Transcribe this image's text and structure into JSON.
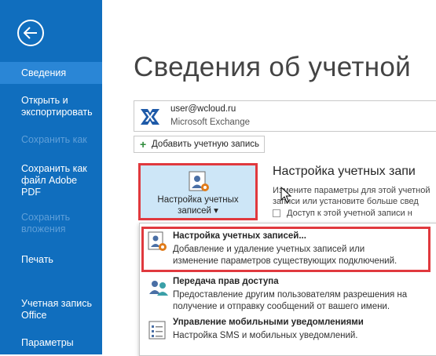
{
  "sidebar": {
    "back_icon": "back-arrow-icon",
    "items": [
      {
        "label": "Сведения",
        "state": "active"
      },
      {
        "label": "Открыть и\nэкспортировать",
        "state": "normal"
      },
      {
        "label": "Сохранить как",
        "state": "disabled"
      },
      {
        "label": "Сохранить как\nфайл Adobe\nPDF",
        "state": "normal"
      },
      {
        "label": "Сохранить\nвложения",
        "state": "disabled"
      },
      {
        "label": "Печать",
        "state": "normal"
      },
      {
        "label": "Учетная запись\nOffice",
        "state": "normal"
      },
      {
        "label": "Параметры",
        "state": "normal"
      }
    ]
  },
  "main": {
    "title": "Сведения об учетной",
    "account": {
      "email": "user@wcloud.ru",
      "type": "Microsoft Exchange"
    },
    "add_account_label": "Добавить учетную запись",
    "settings_button_label": "Настройка учетных\nзаписей ▾",
    "section": {
      "title": "Настройка учетных запи",
      "desc": "Измените параметры для этой учетной\nзаписи или установите больше свед",
      "bullet": "Доступ к этой учетной записи н"
    },
    "dropdown": [
      {
        "title": "Настройка учетных записей...",
        "desc": "Добавление и удаление учетных записей или\nизменение параметров существующих подключений."
      },
      {
        "title": "Передача прав доступа",
        "desc": "Предоставление другим пользователям разрешения на\nполучение и отправку сообщений от вашего имени."
      },
      {
        "title": "Управление мобильными уведомлениями",
        "desc": "Настройка SMS и мобильных уведомлений."
      }
    ]
  },
  "colors": {
    "sidebar_bg": "#106ebe",
    "active_item": "#2a86d6",
    "highlight_border": "#e0393e"
  }
}
